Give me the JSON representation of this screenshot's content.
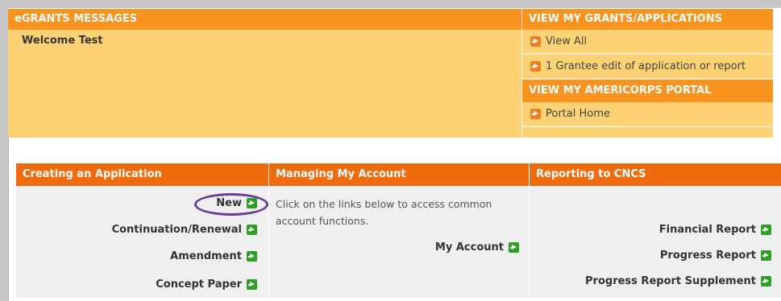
{
  "messages": {
    "header": "eGRANTS MESSAGES",
    "welcome": "Welcome Test"
  },
  "grants": {
    "header": "VIEW MY GRANTS/APPLICATIONS",
    "view_all": "View All",
    "grantee_edit": "1 Grantee edit of application or report",
    "americorps_header": "VIEW MY AMERICORPS PORTAL",
    "portal_home": "Portal Home"
  },
  "creating": {
    "header": "Creating an Application",
    "links": [
      "New",
      "Continuation/Renewal",
      "Amendment",
      "Concept Paper"
    ]
  },
  "account": {
    "header": "Managing My Account",
    "description": "Click on the links below to access common account functions.",
    "my_account": "My Account"
  },
  "reporting": {
    "header": "Reporting to CNCS",
    "links": [
      "Financial Report",
      "Progress Report",
      "Progress Report Supplement"
    ]
  },
  "colors": {
    "header_orange": "#f7931e",
    "section_orange": "#ee6c0e",
    "panel_yellow": "#fdd275",
    "arrow_green": "#2e9e24",
    "highlight_circle": "#6a3b97"
  }
}
